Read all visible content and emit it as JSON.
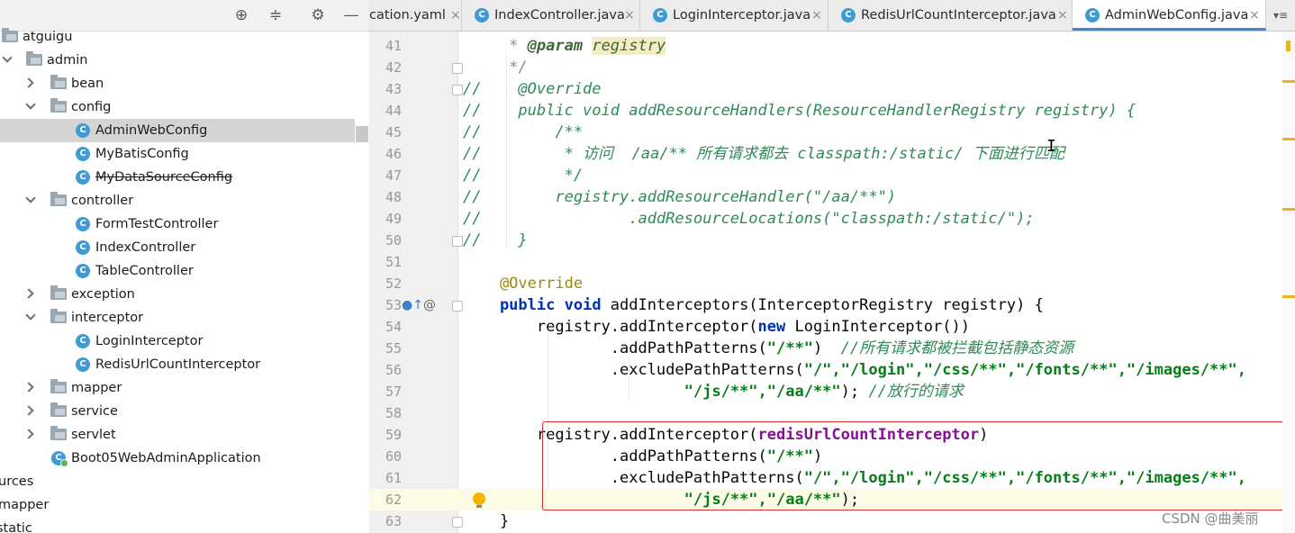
{
  "tree": {
    "rows": [
      {
        "label": "atguigu",
        "type": "folder",
        "arrow": "none"
      },
      {
        "label": "admin",
        "type": "folder",
        "arrow": "down"
      },
      {
        "label": "bean",
        "type": "folder",
        "arrow": "right"
      },
      {
        "label": "config",
        "type": "folder",
        "arrow": "down"
      },
      {
        "label": "AdminWebConfig",
        "type": "class"
      },
      {
        "label": "MyBatisConfig",
        "type": "class"
      },
      {
        "label": "MyDataSourceConfig",
        "type": "class"
      },
      {
        "label": "controller",
        "type": "folder",
        "arrow": "down"
      },
      {
        "label": "FormTestController",
        "type": "class"
      },
      {
        "label": "IndexController",
        "type": "class"
      },
      {
        "label": "TableController",
        "type": "class"
      },
      {
        "label": "exception",
        "type": "folder",
        "arrow": "right"
      },
      {
        "label": "interceptor",
        "type": "folder",
        "arrow": "down"
      },
      {
        "label": "LoginInterceptor",
        "type": "class"
      },
      {
        "label": "RedisUrlCountInterceptor",
        "type": "class"
      },
      {
        "label": "mapper",
        "type": "folder",
        "arrow": "right"
      },
      {
        "label": "service",
        "type": "folder",
        "arrow": "right"
      },
      {
        "label": "servlet",
        "type": "folder",
        "arrow": "right"
      },
      {
        "label": "Boot05WebAdminApplication",
        "type": "app"
      },
      {
        "label": "urces",
        "type": "text"
      },
      {
        "label": "mapper",
        "type": "text"
      },
      {
        "label": "static",
        "type": "text"
      }
    ],
    "toolbar_icons": [
      "locate-icon",
      "collapse-icon",
      "gear-icon",
      "minimize-icon"
    ]
  },
  "tabs": [
    {
      "label": "cation.yaml",
      "active": false
    },
    {
      "label": "IndexController.java",
      "active": false
    },
    {
      "label": "LoginInterceptor.java",
      "active": false
    },
    {
      "label": "RedisUrlCountInterceptor.java",
      "active": false
    },
    {
      "label": "AdminWebConfig.java",
      "active": true
    }
  ],
  "tab_close_glyph": "×",
  "tab_overflow": "▾≡",
  "editor": {
    "line_numbers": [
      "41",
      "42",
      "43",
      "44",
      "45",
      "46",
      "47",
      "48",
      "49",
      "50",
      "51",
      "52",
      "53",
      "54",
      "55",
      "56",
      "57",
      "58",
      "59",
      "60",
      "61",
      "62",
      "63"
    ],
    "tokens": {
      "l41_star": "     * ",
      "l41_tag": "@param",
      "l41_sp": " ",
      "l41_param": "registry",
      "l42": "     */",
      "l43": "//    @Override",
      "l44": "//    public void addResourceHandlers(ResourceHandlerRegistry registry) {",
      "l45": "//        /**",
      "l46": "//         * 访问  /aa/** 所有请求都去 classpath:/static/ 下面进行匹配",
      "l47": "//         */",
      "l48": "//        registry.addResourceHandler(\"/aa/**\")",
      "l49": "//                .addResourceLocations(\"classpath:/static/\");",
      "l50": "//    }",
      "l52_ann": "    @Override",
      "l53_public": "    public",
      "l53_void": "void",
      "l53_rest": " addInterceptors(InterceptorRegistry registry) {",
      "l54_a": "        registry.addInterceptor(",
      "l54_new": "new",
      "l54_b": " LoginInterceptor())",
      "l55_a": "                .addPathPatterns(",
      "l55_s": "\"/**\"",
      "l55_c": "  //所有请求都被拦截包括静态资源",
      "l56_a": "                .excludePathPatterns(",
      "l56_s": "\"/\",\"/login\",\"/css/**\",\"/fonts/**\",\"/images/**\",",
      "l57_pad": "                        ",
      "l57_s": "\"/js/**\",\"/aa/**\"",
      "l57_b": "); ",
      "l57_c": "//放行的请求",
      "l59_a": "        registry.addInterceptor(",
      "l59_f": "redisUrlCountInterceptor",
      "l59_b": ")",
      "l60_a": "                .addPathPatterns(",
      "l60_s": "\"/**\"",
      "l60_b": ")",
      "l61_a": "                .excludePathPatterns(",
      "l61_s": "\"/\",\"/login\",\"/css/**\",\"/fonts/**\",\"/images/**\",",
      "l62_pad": "                        ",
      "l62_s": "\"/js/**\",\"/aa/**\"",
      "l62_b": ");",
      "l63": "    }"
    },
    "gutter_icons": {
      "override": "●↑",
      "at": "@"
    }
  },
  "cursor_glyph": "I",
  "watermark": "CSDN @曲美丽"
}
